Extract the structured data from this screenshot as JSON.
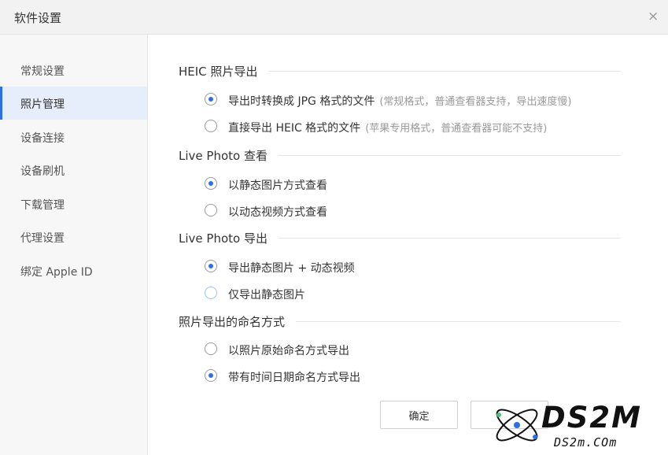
{
  "window": {
    "title": "软件设置",
    "close_glyph": "×"
  },
  "sidebar": {
    "items": [
      {
        "label": "常规设置",
        "active": false
      },
      {
        "label": "照片管理",
        "active": true
      },
      {
        "label": "设备连接",
        "active": false
      },
      {
        "label": "设备刷机",
        "active": false
      },
      {
        "label": "下载管理",
        "active": false
      },
      {
        "label": "代理设置",
        "active": false
      },
      {
        "label": "绑定 Apple ID",
        "active": false
      }
    ]
  },
  "main": {
    "sections": [
      {
        "title": "HEIC 照片导出",
        "options": [
          {
            "label": "导出时转换成 JPG 格式的文件",
            "hint": "(常规格式，普通查看器支持，导出速度慢)",
            "checked": true
          },
          {
            "label": "直接导出 HEIC 格式的文件",
            "hint": "(苹果专用格式，普通查看器可能不支持)",
            "checked": false
          }
        ]
      },
      {
        "title": "Live Photo 查看",
        "options": [
          {
            "label": "以静态图片方式查看",
            "hint": "",
            "checked": true
          },
          {
            "label": "以动态视频方式查看",
            "hint": "",
            "checked": false
          }
        ]
      },
      {
        "title": "Live Photo 导出",
        "options": [
          {
            "label": "导出静态图片 + 动态视频",
            "hint": "",
            "checked": true
          },
          {
            "label": "仅导出静态图片",
            "hint": "",
            "checked": false
          }
        ]
      },
      {
        "title": "照片导出的命名方式",
        "options": [
          {
            "label": "以照片原始命名方式导出",
            "hint": "",
            "checked": false
          },
          {
            "label": "带有时间日期命名方式导出",
            "hint": "",
            "checked": true
          }
        ]
      }
    ]
  },
  "footer": {
    "ok_label": "确定",
    "cancel_label": ""
  },
  "watermark": {
    "big": "DS2M",
    "small": "DS2m.COm"
  },
  "colors": {
    "accent": "#2f6fe6",
    "sidebar_bg": "#f7f7f7",
    "active_bg": "#e6eefc"
  }
}
